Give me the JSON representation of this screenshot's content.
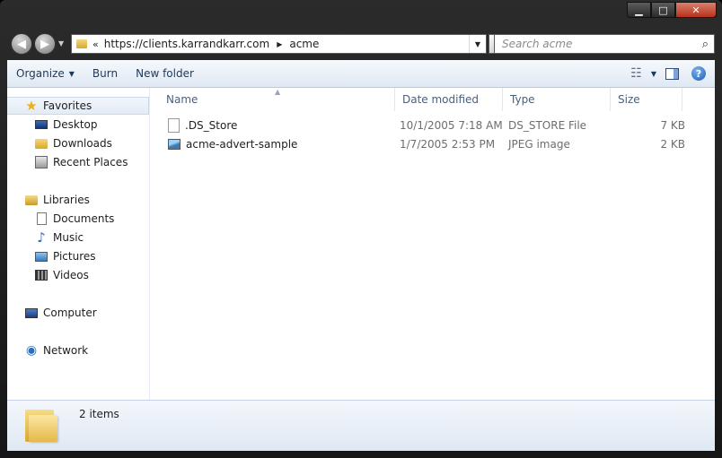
{
  "window": {
    "minimize_glyph": "▁",
    "maximize_glyph": "□",
    "close_glyph": "✕"
  },
  "nav": {
    "back_glyph": "◀",
    "forward_glyph": "▶",
    "address": {
      "chevron": "«",
      "segments": [
        "https://clients.karrandkarr.com",
        "acme"
      ],
      "separator": "▶"
    },
    "search": {
      "placeholder": "Search acme"
    },
    "icons": [
      "folder-icon",
      "refresh-icon",
      "search-icon"
    ]
  },
  "toolbar": {
    "organize": "Organize",
    "burn": "Burn",
    "new_folder": "New folder"
  },
  "sidebar": {
    "favorites": {
      "label": "Favorites",
      "items": [
        {
          "label": "Desktop"
        },
        {
          "label": "Downloads"
        },
        {
          "label": "Recent Places"
        }
      ]
    },
    "libraries": {
      "label": "Libraries",
      "items": [
        {
          "label": "Documents"
        },
        {
          "label": "Music"
        },
        {
          "label": "Pictures"
        },
        {
          "label": "Videos"
        }
      ]
    },
    "computer": {
      "label": "Computer"
    },
    "network": {
      "label": "Network"
    }
  },
  "filelist": {
    "columns": {
      "name": "Name",
      "date": "Date modified",
      "type": "Type",
      "size": "Size"
    },
    "rows": [
      {
        "name": ".DS_Store",
        "date": "10/1/2005 7:18 AM",
        "type": "DS_STORE File",
        "size": "7 KB",
        "icon": "file-icon"
      },
      {
        "name": "acme-advert-sample",
        "date": "1/7/2005 2:53 PM",
        "type": "JPEG image",
        "size": "2 KB",
        "icon": "image-icon"
      }
    ]
  },
  "details": {
    "status": "2 items"
  },
  "colors": {
    "toolbar_text": "#1e395b",
    "header_text": "#4c607a",
    "frame": "#1f1f1f"
  }
}
